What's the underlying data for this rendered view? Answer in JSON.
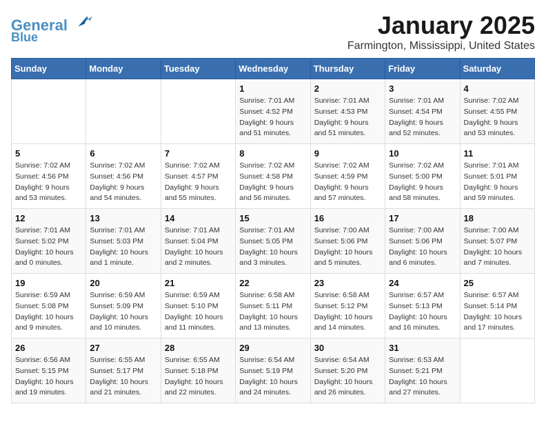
{
  "header": {
    "logo_line1": "General",
    "logo_line2": "Blue",
    "month_year": "January 2025",
    "location": "Farmington, Mississippi, United States"
  },
  "weekdays": [
    "Sunday",
    "Monday",
    "Tuesday",
    "Wednesday",
    "Thursday",
    "Friday",
    "Saturday"
  ],
  "weeks": [
    [
      {
        "day": "",
        "info": ""
      },
      {
        "day": "",
        "info": ""
      },
      {
        "day": "",
        "info": ""
      },
      {
        "day": "1",
        "info": "Sunrise: 7:01 AM\nSunset: 4:52 PM\nDaylight: 9 hours\nand 51 minutes."
      },
      {
        "day": "2",
        "info": "Sunrise: 7:01 AM\nSunset: 4:53 PM\nDaylight: 9 hours\nand 51 minutes."
      },
      {
        "day": "3",
        "info": "Sunrise: 7:01 AM\nSunset: 4:54 PM\nDaylight: 9 hours\nand 52 minutes."
      },
      {
        "day": "4",
        "info": "Sunrise: 7:02 AM\nSunset: 4:55 PM\nDaylight: 9 hours\nand 53 minutes."
      }
    ],
    [
      {
        "day": "5",
        "info": "Sunrise: 7:02 AM\nSunset: 4:56 PM\nDaylight: 9 hours\nand 53 minutes."
      },
      {
        "day": "6",
        "info": "Sunrise: 7:02 AM\nSunset: 4:56 PM\nDaylight: 9 hours\nand 54 minutes."
      },
      {
        "day": "7",
        "info": "Sunrise: 7:02 AM\nSunset: 4:57 PM\nDaylight: 9 hours\nand 55 minutes."
      },
      {
        "day": "8",
        "info": "Sunrise: 7:02 AM\nSunset: 4:58 PM\nDaylight: 9 hours\nand 56 minutes."
      },
      {
        "day": "9",
        "info": "Sunrise: 7:02 AM\nSunset: 4:59 PM\nDaylight: 9 hours\nand 57 minutes."
      },
      {
        "day": "10",
        "info": "Sunrise: 7:02 AM\nSunset: 5:00 PM\nDaylight: 9 hours\nand 58 minutes."
      },
      {
        "day": "11",
        "info": "Sunrise: 7:01 AM\nSunset: 5:01 PM\nDaylight: 9 hours\nand 59 minutes."
      }
    ],
    [
      {
        "day": "12",
        "info": "Sunrise: 7:01 AM\nSunset: 5:02 PM\nDaylight: 10 hours\nand 0 minutes."
      },
      {
        "day": "13",
        "info": "Sunrise: 7:01 AM\nSunset: 5:03 PM\nDaylight: 10 hours\nand 1 minute."
      },
      {
        "day": "14",
        "info": "Sunrise: 7:01 AM\nSunset: 5:04 PM\nDaylight: 10 hours\nand 2 minutes."
      },
      {
        "day": "15",
        "info": "Sunrise: 7:01 AM\nSunset: 5:05 PM\nDaylight: 10 hours\nand 3 minutes."
      },
      {
        "day": "16",
        "info": "Sunrise: 7:00 AM\nSunset: 5:06 PM\nDaylight: 10 hours\nand 5 minutes."
      },
      {
        "day": "17",
        "info": "Sunrise: 7:00 AM\nSunset: 5:06 PM\nDaylight: 10 hours\nand 6 minutes."
      },
      {
        "day": "18",
        "info": "Sunrise: 7:00 AM\nSunset: 5:07 PM\nDaylight: 10 hours\nand 7 minutes."
      }
    ],
    [
      {
        "day": "19",
        "info": "Sunrise: 6:59 AM\nSunset: 5:08 PM\nDaylight: 10 hours\nand 9 minutes."
      },
      {
        "day": "20",
        "info": "Sunrise: 6:59 AM\nSunset: 5:09 PM\nDaylight: 10 hours\nand 10 minutes."
      },
      {
        "day": "21",
        "info": "Sunrise: 6:59 AM\nSunset: 5:10 PM\nDaylight: 10 hours\nand 11 minutes."
      },
      {
        "day": "22",
        "info": "Sunrise: 6:58 AM\nSunset: 5:11 PM\nDaylight: 10 hours\nand 13 minutes."
      },
      {
        "day": "23",
        "info": "Sunrise: 6:58 AM\nSunset: 5:12 PM\nDaylight: 10 hours\nand 14 minutes."
      },
      {
        "day": "24",
        "info": "Sunrise: 6:57 AM\nSunset: 5:13 PM\nDaylight: 10 hours\nand 16 minutes."
      },
      {
        "day": "25",
        "info": "Sunrise: 6:57 AM\nSunset: 5:14 PM\nDaylight: 10 hours\nand 17 minutes."
      }
    ],
    [
      {
        "day": "26",
        "info": "Sunrise: 6:56 AM\nSunset: 5:15 PM\nDaylight: 10 hours\nand 19 minutes."
      },
      {
        "day": "27",
        "info": "Sunrise: 6:55 AM\nSunset: 5:17 PM\nDaylight: 10 hours\nand 21 minutes."
      },
      {
        "day": "28",
        "info": "Sunrise: 6:55 AM\nSunset: 5:18 PM\nDaylight: 10 hours\nand 22 minutes."
      },
      {
        "day": "29",
        "info": "Sunrise: 6:54 AM\nSunset: 5:19 PM\nDaylight: 10 hours\nand 24 minutes."
      },
      {
        "day": "30",
        "info": "Sunrise: 6:54 AM\nSunset: 5:20 PM\nDaylight: 10 hours\nand 26 minutes."
      },
      {
        "day": "31",
        "info": "Sunrise: 6:53 AM\nSunset: 5:21 PM\nDaylight: 10 hours\nand 27 minutes."
      },
      {
        "day": "",
        "info": ""
      }
    ]
  ]
}
